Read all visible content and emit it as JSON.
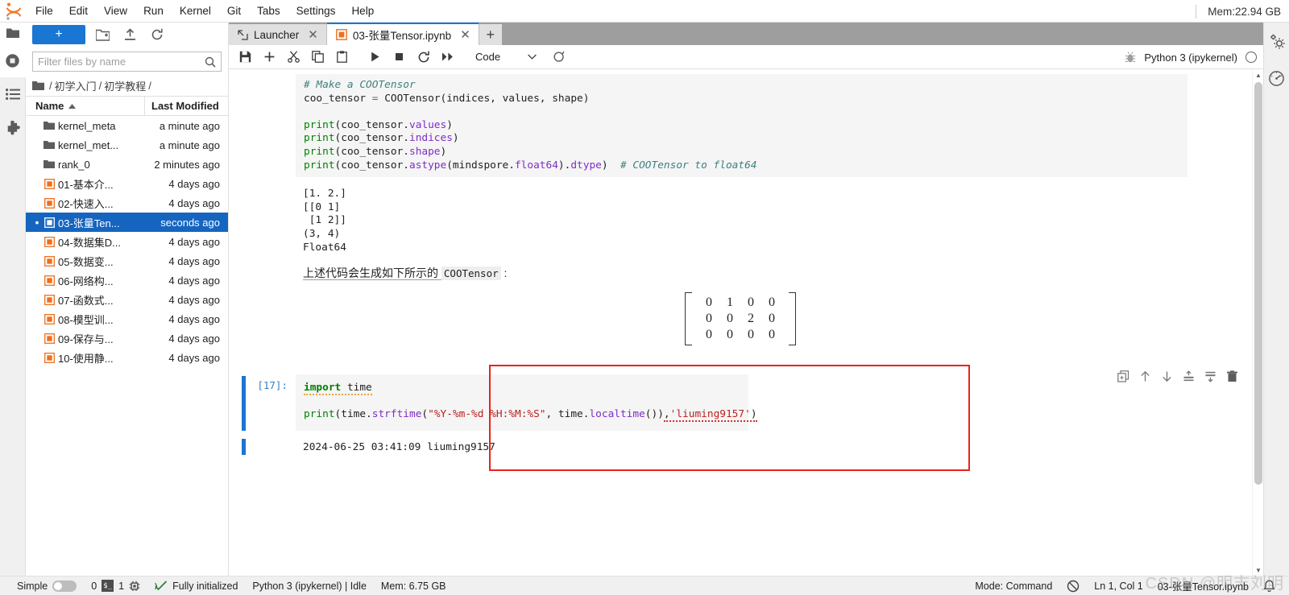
{
  "menubar": {
    "items": [
      "File",
      "Edit",
      "View",
      "Run",
      "Kernel",
      "Git",
      "Tabs",
      "Settings",
      "Help"
    ],
    "memory": "Mem:22.94 GB"
  },
  "filebrowser": {
    "new_launcher_label": "+",
    "filter_placeholder": "Filter files by name",
    "filter_value": "",
    "breadcrumb": [
      "/",
      "初学入门",
      "/",
      "初学教程",
      "/"
    ],
    "columns": {
      "name": "Name",
      "modified": "Last Modified"
    },
    "items": [
      {
        "name": "kernel_meta",
        "modified": "a minute ago",
        "type": "folder",
        "selected": false
      },
      {
        "name": "kernel_met...",
        "modified": "a minute ago",
        "type": "folder",
        "selected": false
      },
      {
        "name": "rank_0",
        "modified": "2 minutes ago",
        "type": "folder",
        "selected": false
      },
      {
        "name": "01-基本介...",
        "modified": "4 days ago",
        "type": "notebook",
        "selected": false
      },
      {
        "name": "02-快速入...",
        "modified": "4 days ago",
        "type": "notebook",
        "selected": false
      },
      {
        "name": "03-张量Ten...",
        "modified": "seconds ago",
        "type": "notebook",
        "selected": true
      },
      {
        "name": "04-数据集D...",
        "modified": "4 days ago",
        "type": "notebook",
        "selected": false
      },
      {
        "name": "05-数据变...",
        "modified": "4 days ago",
        "type": "notebook",
        "selected": false
      },
      {
        "name": "06-网络构...",
        "modified": "4 days ago",
        "type": "notebook",
        "selected": false
      },
      {
        "name": "07-函数式...",
        "modified": "4 days ago",
        "type": "notebook",
        "selected": false
      },
      {
        "name": "08-模型训...",
        "modified": "4 days ago",
        "type": "notebook",
        "selected": false
      },
      {
        "name": "09-保存与...",
        "modified": "4 days ago",
        "type": "notebook",
        "selected": false
      },
      {
        "name": "10-使用静...",
        "modified": "4 days ago",
        "type": "notebook",
        "selected": false
      }
    ]
  },
  "tabs": [
    {
      "label": "Launcher",
      "icon": "launcher-icon",
      "active": false
    },
    {
      "label": "03-张量Tensor.ipynb",
      "icon": "notebook-icon",
      "active": true
    }
  ],
  "notebook_toolbar": {
    "cell_type": "Code",
    "kernel_name": "Python 3 (ipykernel)",
    "buttons": [
      "save",
      "insert-cell",
      "cut",
      "copy",
      "paste",
      "run",
      "stop",
      "restart",
      "restart-run-all"
    ]
  },
  "cells": [
    {
      "id": "coo-code-cell",
      "prompt": "",
      "source_lines": [
        "# Make a COOTensor",
        "coo_tensor = COOTensor(indices, values, shape)",
        "",
        "print(coo_tensor.values)",
        "print(coo_tensor.indices)",
        "print(coo_tensor.shape)",
        "print(coo_tensor.astype(mindspore.float64).dtype)  # COOTensor to float64"
      ]
    },
    {
      "id": "coo-output",
      "output_lines": [
        "[1. 2.]",
        "[[0 1]",
        " [1 2]]",
        "(3, 4)",
        "Float64"
      ]
    },
    {
      "id": "markdown-note",
      "text_before": "上述代码会生成如下所示的 ",
      "code_inline": "COOTensor",
      "text_after": " :"
    },
    {
      "id": "matrix-display",
      "matrix": [
        [
          0,
          1,
          0,
          0
        ],
        [
          0,
          0,
          2,
          0
        ],
        [
          0,
          0,
          0,
          0
        ]
      ]
    },
    {
      "id": "time-cell",
      "prompt": "[17]:",
      "source_lines": [
        "import time",
        "",
        "print(time.strftime(\"%Y-%m-%d %H:%M:%S\", time.localtime()),'liuming9157')"
      ],
      "output_lines": [
        "2024-06-25 03:41:09 liuming9157"
      ],
      "selected_outline_color": "#e8241b"
    }
  ],
  "cell_toolbar": {
    "icons": [
      "duplicate-cell-icon",
      "move-cell-up-icon",
      "move-cell-down-icon",
      "insert-cell-above-icon",
      "insert-cell-below-icon",
      "delete-cell-icon"
    ]
  },
  "statusbar": {
    "simple_label": "Simple",
    "simple_on": false,
    "kernel_count": "0",
    "terminal_count": "1",
    "init_status": "Fully initialized",
    "kernel_status": "Python 3 (ipykernel) | Idle",
    "memory": "Mem: 6.75 GB",
    "mode": "Mode: Command",
    "cursor": "Ln 1, Col 1",
    "filename": "03-张量Tensor.ipynb"
  },
  "watermark": "CSDN @明志刘明",
  "colors": {
    "accent_blue": "#1976d2",
    "selection_blue": "#1565c0",
    "red_outline": "#e8241b",
    "notebook_orange": "#ee6f1e"
  }
}
